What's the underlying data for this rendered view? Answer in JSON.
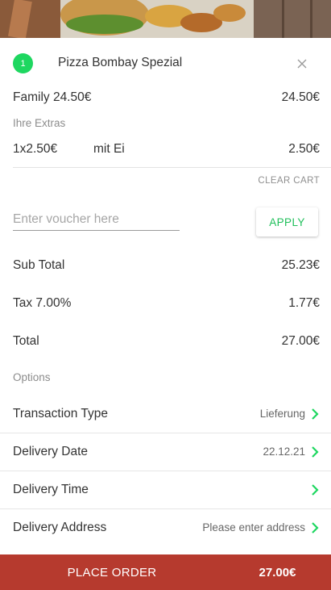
{
  "cart": {
    "quantity": "1",
    "item_name": "Pizza Bombay Spezial",
    "size_label": "Family 24.50€",
    "size_price": "24.50€",
    "extras_heading": "Ihre Extras",
    "extra_qty_price": "1x2.50€",
    "extra_name": "mit Ei",
    "extra_price": "2.50€",
    "clear_cart_label": "CLEAR CART"
  },
  "voucher": {
    "placeholder": "Enter voucher here",
    "apply_label": "APPLY"
  },
  "summary": {
    "subtotal_label": "Sub Total",
    "subtotal_value": "25.23€",
    "tax_label": "Tax 7.00%",
    "tax_value": "1.77€",
    "total_label": "Total",
    "total_value": "27.00€"
  },
  "options": {
    "heading": "Options",
    "items": [
      {
        "label": "Transaction Type",
        "value": "Lieferung"
      },
      {
        "label": "Delivery Date",
        "value": "22.12.21"
      },
      {
        "label": "Delivery Time",
        "value": ""
      },
      {
        "label": "Delivery Address",
        "value": "Please enter address"
      }
    ]
  },
  "order": {
    "button_label": "PLACE ORDER",
    "total": "27.00€"
  },
  "colors": {
    "accent_green": "#1ed760",
    "order_bar": "#b63a2e"
  }
}
